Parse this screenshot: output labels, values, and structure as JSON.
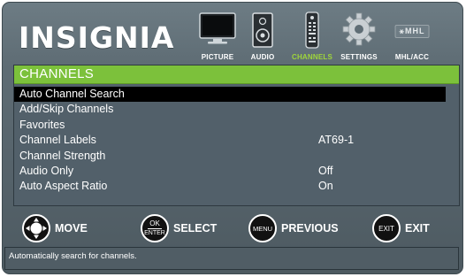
{
  "header": {
    "brand": "INSIGNIA",
    "tabs": [
      {
        "label": "PICTURE",
        "icon": "tv-icon",
        "active": false
      },
      {
        "label": "AUDIO",
        "icon": "speaker-icon",
        "active": false
      },
      {
        "label": "CHANNELS",
        "icon": "remote-icon",
        "active": true
      },
      {
        "label": "SETTINGS",
        "icon": "gear-icon",
        "active": false
      },
      {
        "label": "MHL/ACC",
        "icon": "mhl-icon",
        "badge": "⚹MHL",
        "active": false
      }
    ]
  },
  "panel": {
    "title": "CHANNELS",
    "items": [
      {
        "name": "Auto Channel Search",
        "value": ""
      },
      {
        "name": "Add/Skip Channels",
        "value": ""
      },
      {
        "name": "Favorites",
        "value": ""
      },
      {
        "name": "Channel Labels",
        "value": "AT69-1"
      },
      {
        "name": "Channel Strength",
        "value": ""
      },
      {
        "name": "Audio Only",
        "value": "Off"
      },
      {
        "name": "Auto Aspect Ratio",
        "value": "On"
      }
    ],
    "selected_index": 0
  },
  "buttons": {
    "move": {
      "label": "MOVE"
    },
    "select": {
      "label": "SELECT",
      "key_top": "OK",
      "key_bottom": "ENTER"
    },
    "previous": {
      "label": "PREVIOUS",
      "key": "MENU"
    },
    "exit": {
      "label": "EXIT",
      "key": "EXIT"
    }
  },
  "status": {
    "text": "Automatically search for channels."
  },
  "colors": {
    "accent": "#7cc13b",
    "active_tab": "#9fd63a",
    "background": "#56636b",
    "selected_row": "#000000"
  }
}
